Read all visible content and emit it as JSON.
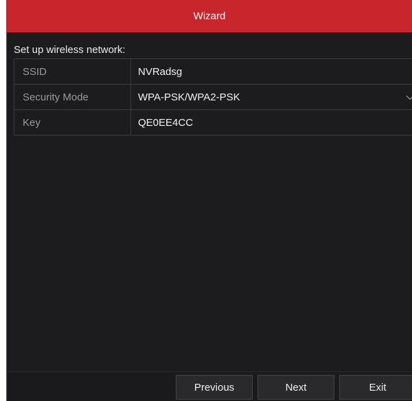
{
  "window": {
    "title": "Wizard"
  },
  "section": {
    "label": "Set up wireless network:"
  },
  "form": {
    "rows": [
      {
        "label": "SSID",
        "value": "NVRadsg"
      },
      {
        "label": "Security Mode",
        "value": "WPA-PSK/WPA2-PSK"
      },
      {
        "label": "Key",
        "value": "QE0EE4CC"
      }
    ]
  },
  "footer": {
    "previous_label": "Previous",
    "next_label": "Next",
    "exit_label": "Exit"
  },
  "colors": {
    "title_bar": "#c8252c",
    "background": "#1c1c1e",
    "label_text": "#9a9a9e",
    "value_text": "#f2f2f2"
  },
  "icons": {
    "security_mode_dropdown": "chevron-down-icon"
  }
}
